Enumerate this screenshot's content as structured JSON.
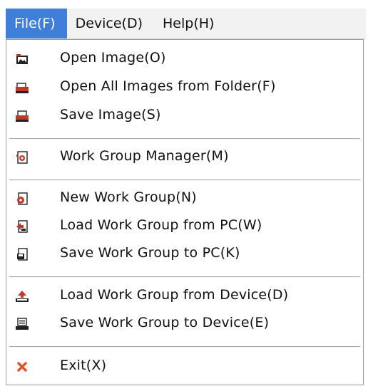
{
  "menubar": {
    "items": [
      {
        "label": "File(F)"
      },
      {
        "label": "Device(D)"
      },
      {
        "label": "Help(H)"
      }
    ]
  },
  "file_menu": {
    "items": [
      {
        "label": "Open Image(O)",
        "icon": "open-image-icon"
      },
      {
        "label": "Open All Images from Folder(F)",
        "icon": "open-folder-images-icon"
      },
      {
        "label": "Save Image(S)",
        "icon": "save-image-icon"
      },
      {
        "label": "Work Group Manager(M)",
        "icon": "work-group-manager-icon"
      },
      {
        "label": "New Work Group(N)",
        "icon": "new-work-group-icon"
      },
      {
        "label": "Load Work Group from PC(W)",
        "icon": "load-work-group-pc-icon"
      },
      {
        "label": "Save Work Group to PC(K)",
        "icon": "save-work-group-pc-icon"
      },
      {
        "label": "Load Work Group from Device(D)",
        "icon": "load-work-group-device-icon"
      },
      {
        "label": "Save Work Group to Device(E)",
        "icon": "save-work-group-device-icon"
      },
      {
        "label": "Exit(X)",
        "icon": "exit-icon"
      }
    ]
  },
  "colors": {
    "active_menu_bg": "#3f7fd9",
    "exit_icon": "#e0531f",
    "doc_icon_red": "#c0392b"
  }
}
